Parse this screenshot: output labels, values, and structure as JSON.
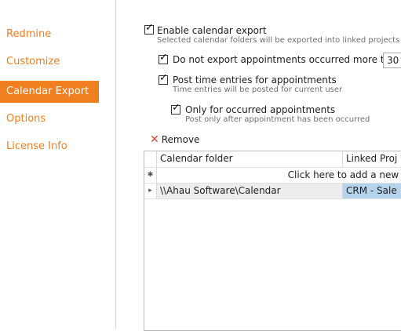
{
  "sidebar": {
    "items": [
      {
        "label": "Redmine",
        "active": false
      },
      {
        "label": "Customize",
        "active": false
      },
      {
        "label": "Calendar Export",
        "active": true
      },
      {
        "label": "Options",
        "active": false
      },
      {
        "label": "License Info",
        "active": false
      }
    ]
  },
  "settings": {
    "enable_export": {
      "label": "Enable calendar export",
      "hint": "Selected calendar folders will be exported into linked projects",
      "checked": true
    },
    "no_export_older": {
      "label": "Do not export appointments occurred more than",
      "value": "30",
      "checked": true
    },
    "post_time_entries": {
      "label": "Post time entries for appointments",
      "hint": "Time entries will be posted for current user",
      "checked": true
    },
    "only_occurred": {
      "label": "Only for occurred appointments",
      "hint": "Post only after appointment has been occurred",
      "checked": true
    }
  },
  "toolbar": {
    "remove_label": "Remove"
  },
  "grid": {
    "columns": [
      "Calendar folder",
      "Linked Proj"
    ],
    "new_row_text": "Click here to add a new ro",
    "new_row_marker": "✱",
    "rows": [
      {
        "marker": "▸",
        "folder": "\\\\Ahau Software\\Calendar",
        "project": "CRM - Sale"
      }
    ],
    "selected_cell_color": "#b5d4ec"
  },
  "colors": {
    "accent": "#f07f1f"
  }
}
